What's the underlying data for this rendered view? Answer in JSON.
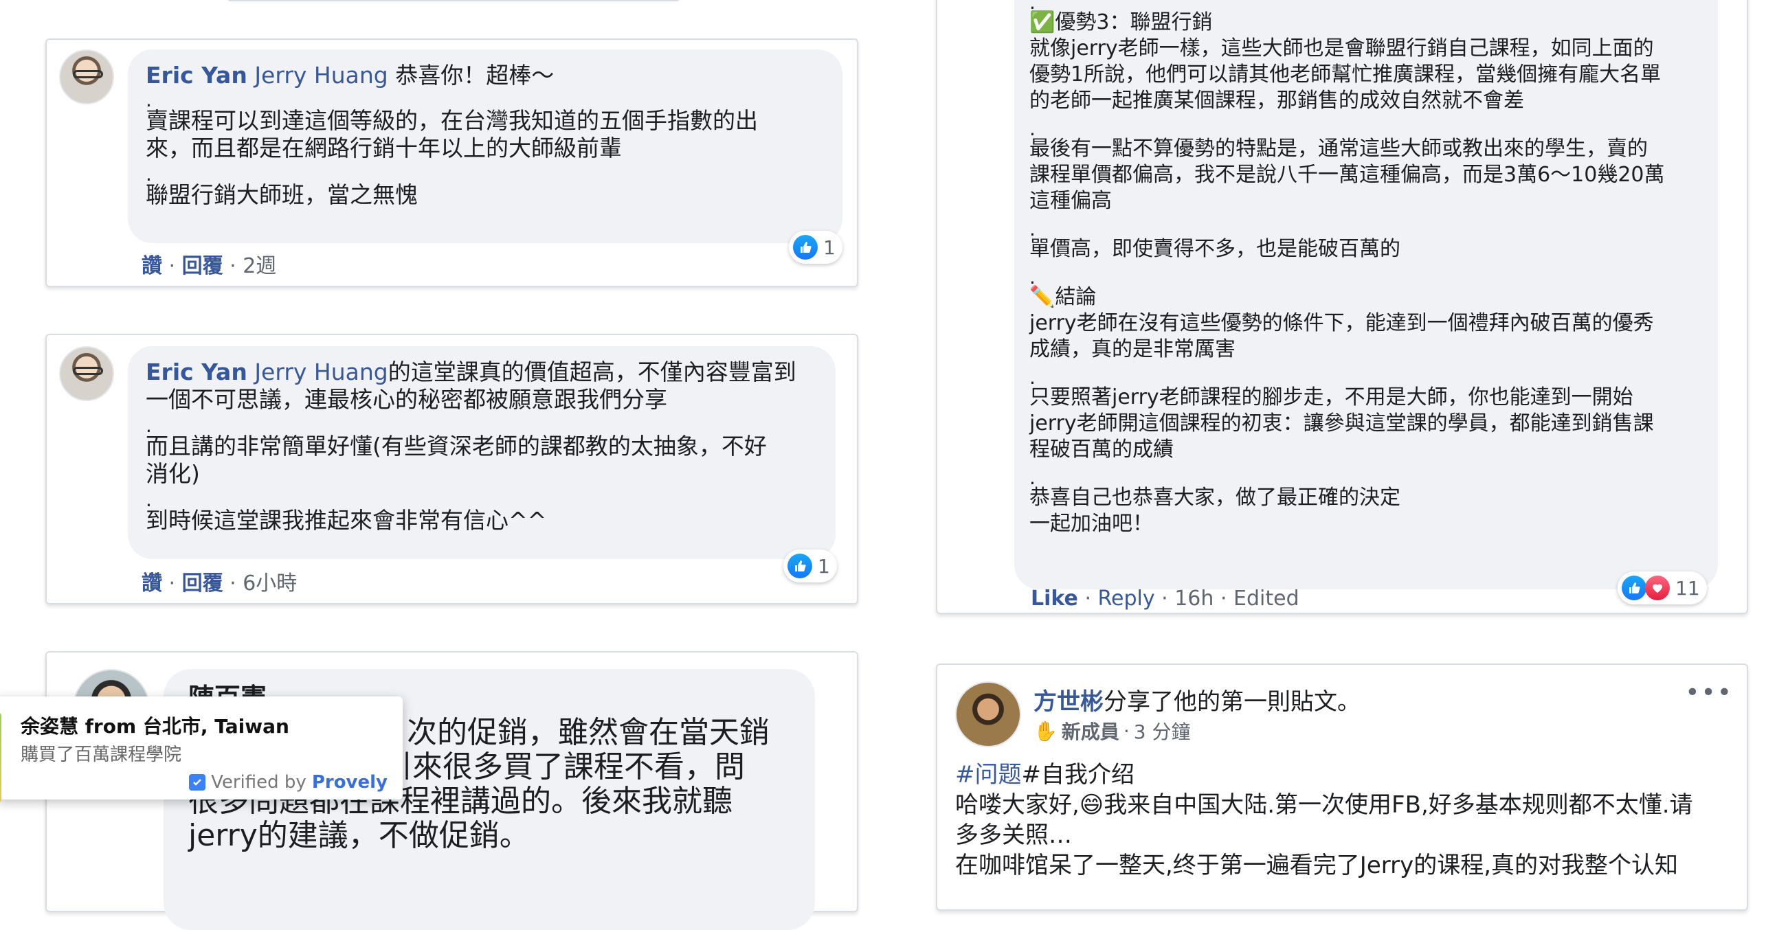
{
  "comment1": {
    "author": "Eric Yan",
    "tag": "Jerry Huang",
    "intro": " 恭喜你！超棒～",
    "lines": [
      ".",
      "賣課程可以到達這個等級的，在台灣我知道的五個手指數的出",
      "來，而且都是在網路行銷十年以上的大師級前輩",
      ".",
      "聯盟行銷大師班，當之無愧"
    ],
    "actions": {
      "like": "讚",
      "reply": "回覆",
      "time": "2週"
    },
    "reactions": "1"
  },
  "comment2": {
    "author": "Eric Yan",
    "tag": "Jerry Huang",
    "intro": "的這堂課真的價值超高，不僅內容豐富到",
    "lines": [
      "一個不可思議，連最核心的秘密都被願意跟我們分享",
      ".",
      "而且講的非常簡單好懂(有些資深老師的課都教的太抽象，不好",
      "消化)",
      ".",
      "到時候這堂課我推起來會非常有信心^^"
    ],
    "actions": {
      "like": "讚",
      "reply": "回覆",
      "time": "6小時"
    },
    "reactions": "1"
  },
  "comment3": {
    "author": "陳百憲",
    "lines": [
      "次的促銷，雖然會在當天銷",
      "引來很多買了課程不看，問",
      "很多問題都在課程裡講過的。後來我就聽",
      "jerry的建議，不做促銷。"
    ]
  },
  "popup": {
    "name": "余姿慧 from 台北市, Taiwan",
    "desc": "購買了百萬課程學院",
    "verified": "Verified by",
    "brand": "Provely"
  },
  "right_comment": {
    "lines": [
      ".",
      "✅優勢3：聯盟行銷",
      "就像jerry老師一樣，這些大師也是會聯盟行銷自己課程，如同上面的",
      "優勢1所說，他們可以請其他老師幫忙推廣課程，當幾個擁有龐大名單",
      "的老師一起推廣某個課程，那銷售的成效自然就不會差",
      ".",
      "最後有一點不算優勢的特點是，通常這些大師或教出來的學生，賣的",
      "課程單價都偏高，我不是說八千一萬這種偏高，而是3萬6～10幾20萬",
      "這種偏高",
      ".",
      "單價高，即使賣得不多，也是能破百萬的",
      ".",
      "✏️結論",
      "jerry老師在沒有這些優勢的條件下，能達到一個禮拜內破百萬的優秀",
      "成績，真的是非常厲害",
      ".",
      "只要照著jerry老師課程的腳步走，不用是大師，你也能達到一開始",
      "jerry老師開這個課程的初衷：讓參與這堂課的學員，都能達到銷售課",
      "程破百萬的成績",
      ".",
      "恭喜自己也恭喜大家，做了最正確的決定",
      "一起加油吧！"
    ],
    "actions": {
      "like": "Like",
      "reply": "Reply",
      "time": "16h",
      "edited": "Edited"
    },
    "reactions": "11"
  },
  "right_post": {
    "author": "方世彬",
    "headline": "分享了他的第一則貼文。",
    "badge": "新成員",
    "time": "3 分鐘",
    "hashtag1": "#问题",
    "hashtag2": "#自我介绍",
    "lines": [
      "哈喽大家好,😄我来自中国大陆.第一次使用FB,好多基本规则都不太懂.请",
      "多多关照…",
      "在咖啡馆呆了一整天,终于第一遍看完了Jerry的课程,真的对我整个认知"
    ],
    "more": "•••"
  }
}
